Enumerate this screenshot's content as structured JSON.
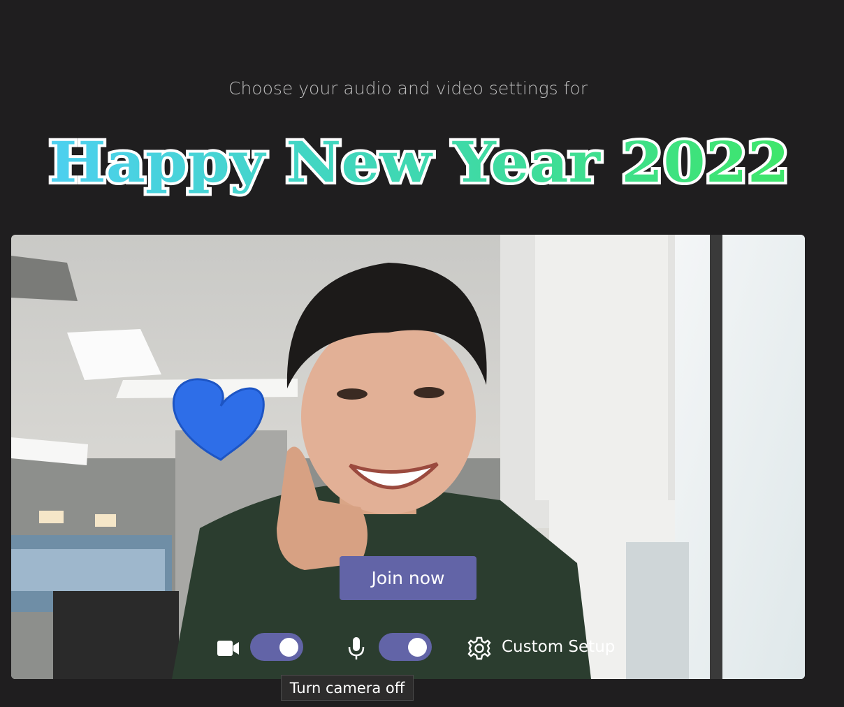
{
  "header": {
    "subtitle": "Choose your audio and video settings for",
    "meeting_title": "Happy New Year 2022"
  },
  "actions": {
    "join_label": "Join now"
  },
  "controls": {
    "camera_icon": "video-camera-icon",
    "camera_on": true,
    "mic_icon": "microphone-icon",
    "mic_on": true,
    "settings_icon": "gear-icon",
    "custom_setup_label": "Custom Setup"
  },
  "tooltip": {
    "text": "Turn camera off"
  },
  "colors": {
    "background": "#1f1e1f",
    "accent": "#6264a7",
    "title_gradient_start": "#4dd0f0",
    "title_gradient_end": "#3ee66a"
  }
}
